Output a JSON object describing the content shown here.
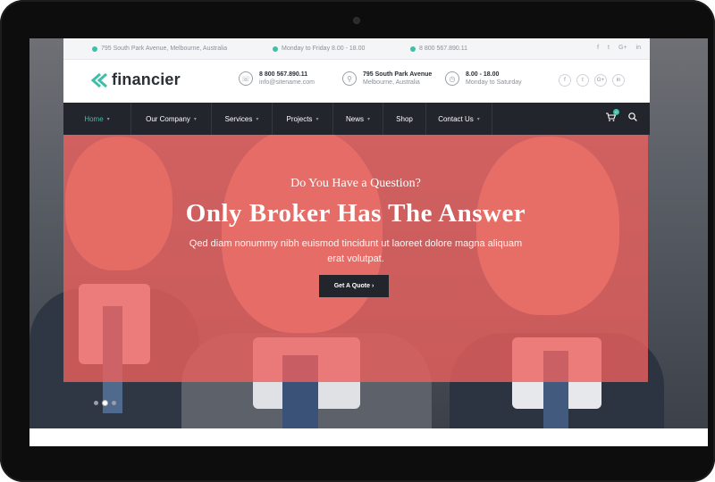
{
  "topbar": {
    "address": "795 South Park Avenue, Melbourne, Australia",
    "hours": "Monday to Friday 8.00 - 18.00",
    "phone": "8 800 567.890.11",
    "social": [
      "f",
      "t",
      "G+",
      "in"
    ]
  },
  "header": {
    "logo": "financier",
    "contact": {
      "line1": "8 800 567.890.11",
      "line2": "info@sitename.com"
    },
    "address": {
      "line1": "795 South Park Avenue",
      "line2": "Melbourne, Australia"
    },
    "hours": {
      "line1": "8.00 - 18.00",
      "line2": "Monday to Saturday"
    },
    "social": [
      "f",
      "t",
      "G+",
      "in"
    ]
  },
  "nav": {
    "items": [
      {
        "label": "Home"
      },
      {
        "label": "Our Company"
      },
      {
        "label": "Services"
      },
      {
        "label": "Projects"
      },
      {
        "label": "News"
      },
      {
        "label": "Shop"
      },
      {
        "label": "Contact Us"
      }
    ],
    "cart_count": "0"
  },
  "hero": {
    "question": "Do You Have a Question?",
    "headline": "Only Broker Has The Answer",
    "body": "Qed diam nonummy nibh euismod tincidunt ut laoreet dolore magna aliquam erat volutpat.",
    "button": "Get A Quote ›"
  },
  "slider": {
    "count": 3,
    "active_index": 1
  },
  "colors": {
    "accent": "#3fbfa9",
    "hero_overlay": "#ec605e",
    "nav_bg": "#22252b"
  },
  "icons": {
    "topbar": [
      "location-icon",
      "clock-icon",
      "phone-icon"
    ],
    "header": [
      "phone-icon",
      "map-pin-icon",
      "clock-icon"
    ],
    "nav": [
      "cart-icon",
      "search-icon"
    ]
  }
}
